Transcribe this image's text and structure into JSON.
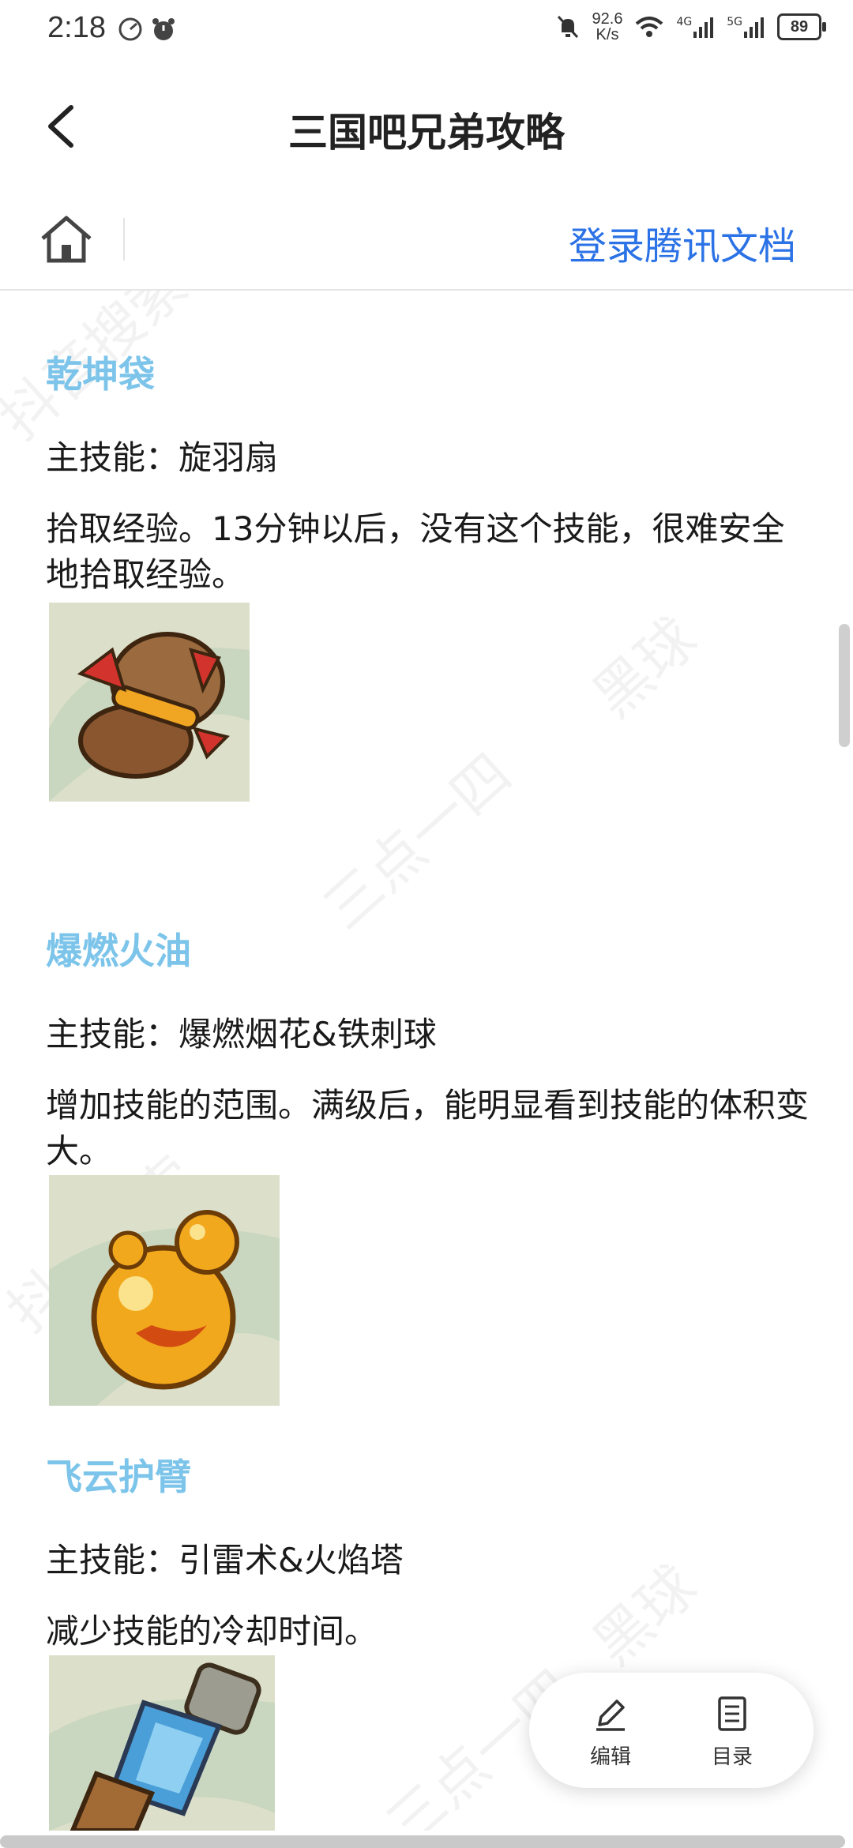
{
  "status_bar": {
    "time": "2:18",
    "net_speed_value": "92.6",
    "net_speed_unit": "K/s",
    "signal_4g": "4G",
    "signal_5g": "5G",
    "battery": "89"
  },
  "header": {
    "title": "三国吧兄弟攻略"
  },
  "toolbar": {
    "login_label": "登录腾讯文档"
  },
  "watermark": {
    "text_a": "抖音搜索",
    "text_b": "三点一四",
    "text_c": "黑球"
  },
  "items": [
    {
      "title": "乾坤袋",
      "skill": "主技能：旋羽扇",
      "desc": "拾取经验。13分钟以后，没有这个技能，很难安全地拾取经验。"
    },
    {
      "title": "爆燃火油",
      "skill": "主技能：爆燃烟花&铁刺球",
      "desc": "增加技能的范围。满级后，能明显看到技能的体积变大。"
    },
    {
      "title": "飞云护臂",
      "skill": "主技能：引雷术&火焰塔",
      "desc": "减少技能的冷却时间。"
    }
  ],
  "fab": {
    "edit_label": "编辑",
    "toc_label": "目录"
  }
}
